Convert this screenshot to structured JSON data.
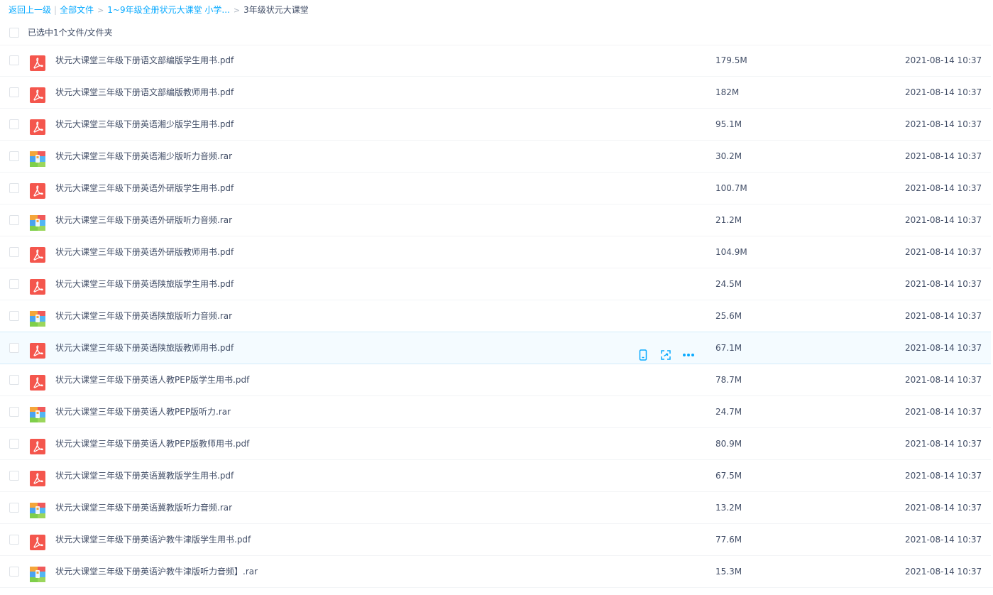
{
  "breadcrumb": {
    "back": "返回上一级",
    "divider": "|",
    "items": [
      "全部文件",
      "1~9年级全册状元大课堂 小学...",
      "3年级状元大课堂"
    ],
    "separator": ">"
  },
  "selection": {
    "label": "已选中1个文件/文件夹"
  },
  "files": [
    {
      "name": "状元大课堂三年级下册语文部编版学生用书.pdf",
      "size": "179.5M",
      "date": "2021-08-14 10:37",
      "type": "pdf"
    },
    {
      "name": "状元大课堂三年级下册语文部编版教师用书.pdf",
      "size": "182M",
      "date": "2021-08-14 10:37",
      "type": "pdf"
    },
    {
      "name": "状元大课堂三年级下册英语湘少版学生用书.pdf",
      "size": "95.1M",
      "date": "2021-08-14 10:37",
      "type": "pdf"
    },
    {
      "name": "状元大课堂三年级下册英语湘少版听力音频.rar",
      "size": "30.2M",
      "date": "2021-08-14 10:37",
      "type": "rar"
    },
    {
      "name": "状元大课堂三年级下册英语外研版学生用书.pdf",
      "size": "100.7M",
      "date": "2021-08-14 10:37",
      "type": "pdf"
    },
    {
      "name": "状元大课堂三年级下册英语外研版听力音频.rar",
      "size": "21.2M",
      "date": "2021-08-14 10:37",
      "type": "rar"
    },
    {
      "name": "状元大课堂三年级下册英语外研版教师用书.pdf",
      "size": "104.9M",
      "date": "2021-08-14 10:37",
      "type": "pdf"
    },
    {
      "name": "状元大课堂三年级下册英语陕旅版学生用书.pdf",
      "size": "24.5M",
      "date": "2021-08-14 10:37",
      "type": "pdf"
    },
    {
      "name": "状元大课堂三年级下册英语陕旅版听力音频.rar",
      "size": "25.6M",
      "date": "2021-08-14 10:37",
      "type": "rar"
    },
    {
      "name": "状元大课堂三年级下册英语陕旅版教师用书.pdf",
      "size": "67.1M",
      "date": "2021-08-14 10:37",
      "type": "pdf",
      "hover": true
    },
    {
      "name": "状元大课堂三年级下册英语人教PEP版学生用书.pdf",
      "size": "78.7M",
      "date": "2021-08-14 10:37",
      "type": "pdf"
    },
    {
      "name": "状元大课堂三年级下册英语人教PEP版听力.rar",
      "size": "24.7M",
      "date": "2021-08-14 10:37",
      "type": "rar"
    },
    {
      "name": "状元大课堂三年级下册英语人教PEP版教师用书.pdf",
      "size": "80.9M",
      "date": "2021-08-14 10:37",
      "type": "pdf"
    },
    {
      "name": "状元大课堂三年级下册英语冀教版学生用书.pdf",
      "size": "67.5M",
      "date": "2021-08-14 10:37",
      "type": "pdf"
    },
    {
      "name": "状元大课堂三年级下册英语冀教版听力音频.rar",
      "size": "13.2M",
      "date": "2021-08-14 10:37",
      "type": "rar"
    },
    {
      "name": "状元大课堂三年级下册英语沪教牛津版学生用书.pdf",
      "size": "77.6M",
      "date": "2021-08-14 10:37",
      "type": "pdf"
    },
    {
      "name": "状元大课堂三年级下册英语沪教牛津版听力音频】.rar",
      "size": "15.3M",
      "date": "2021-08-14 10:37",
      "type": "rar"
    }
  ],
  "row_actions": [
    "phone-icon",
    "share-icon",
    "more-icon"
  ],
  "colors": {
    "link": "#09aaff",
    "text": "#424e67",
    "pdf": "#f4564d",
    "hover_bg": "#f4fbff"
  }
}
